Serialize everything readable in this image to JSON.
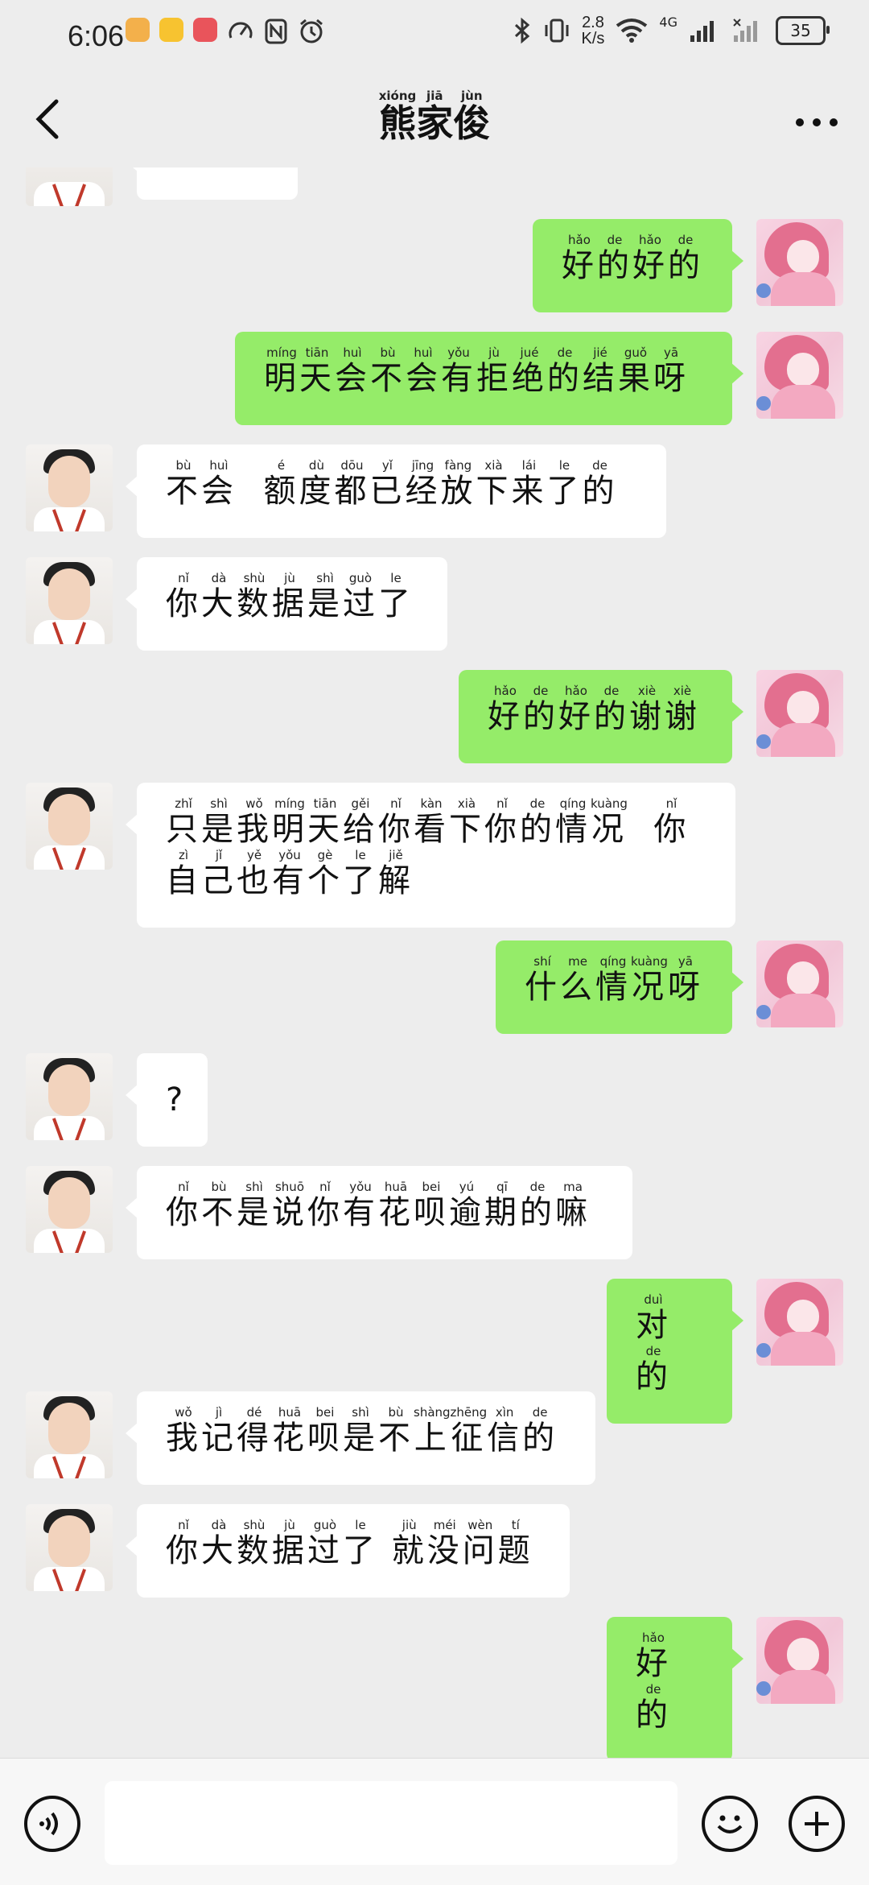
{
  "status_bar": {
    "time": "6:06",
    "net_speed_value": "2.8",
    "net_speed_unit": "K/s",
    "network_type": "4G",
    "battery_level": "35",
    "icons": [
      "bluetooth-icon",
      "vibrate-icon",
      "wifi-icon",
      "signal-icon",
      "nfc-icon",
      "alarm-icon"
    ]
  },
  "header": {
    "title_chars": [
      {
        "ch": "熊",
        "py": "xióng"
      },
      {
        "ch": "家",
        "py": "jiā"
      },
      {
        "ch": "俊",
        "py": "jùn"
      }
    ],
    "back_icon": "chevron-left-icon",
    "more_icon": "more-dots-icon"
  },
  "messages": [
    {
      "side": "right",
      "tokens": [
        {
          "ch": "好",
          "py": "hǎo"
        },
        {
          "ch": "的",
          "py": "de"
        },
        {
          "ch": "好",
          "py": "hǎo"
        },
        {
          "ch": "的",
          "py": "de"
        }
      ]
    },
    {
      "side": "right",
      "tokens": [
        {
          "ch": "明",
          "py": "míng"
        },
        {
          "ch": "天",
          "py": "tiān"
        },
        {
          "ch": "会",
          "py": "huì"
        },
        {
          "ch": "不",
          "py": "bù"
        },
        {
          "ch": "会",
          "py": "huì"
        },
        {
          "ch": "有",
          "py": "yǒu"
        },
        {
          "ch": "拒",
          "py": "jù"
        },
        {
          "ch": "绝",
          "py": "jué"
        },
        {
          "ch": "的",
          "py": "de"
        },
        {
          "ch": "结",
          "py": "jié"
        },
        {
          "ch": "果",
          "py": "guǒ"
        },
        {
          "ch": "呀",
          "py": "yā"
        }
      ]
    },
    {
      "side": "left",
      "tokens": [
        {
          "ch": "不",
          "py": "bù"
        },
        {
          "ch": "会",
          "py": "huì"
        },
        {
          "ch": "  ",
          "py": ""
        },
        {
          "ch": "额",
          "py": "é"
        },
        {
          "ch": "度",
          "py": "dù"
        },
        {
          "ch": "都",
          "py": "dōu"
        },
        {
          "ch": "已",
          "py": "yǐ"
        },
        {
          "ch": "经",
          "py": "jīng"
        },
        {
          "ch": "放",
          "py": "fàng"
        },
        {
          "ch": "下",
          "py": "xià"
        },
        {
          "ch": "来",
          "py": "lái"
        },
        {
          "ch": "了",
          "py": "le"
        },
        {
          "ch": "的",
          "py": "de"
        }
      ]
    },
    {
      "side": "left",
      "tokens": [
        {
          "ch": "你",
          "py": "nǐ"
        },
        {
          "ch": "大",
          "py": "dà"
        },
        {
          "ch": "数",
          "py": "shù"
        },
        {
          "ch": "据",
          "py": "jù"
        },
        {
          "ch": "是",
          "py": "shì"
        },
        {
          "ch": "过",
          "py": "guò"
        },
        {
          "ch": "了",
          "py": "le"
        }
      ]
    },
    {
      "side": "right",
      "tokens": [
        {
          "ch": "好",
          "py": "hǎo"
        },
        {
          "ch": "的",
          "py": "de"
        },
        {
          "ch": "好",
          "py": "hǎo"
        },
        {
          "ch": "的",
          "py": "de"
        },
        {
          "ch": "谢",
          "py": "xiè"
        },
        {
          "ch": "谢",
          "py": "xiè"
        }
      ]
    },
    {
      "side": "left",
      "tokens": [
        {
          "ch": "只",
          "py": "zhǐ"
        },
        {
          "ch": "是",
          "py": "shì"
        },
        {
          "ch": "我",
          "py": "wǒ"
        },
        {
          "ch": "明",
          "py": "míng"
        },
        {
          "ch": "天",
          "py": "tiān"
        },
        {
          "ch": "给",
          "py": "gěi"
        },
        {
          "ch": "你",
          "py": "nǐ"
        },
        {
          "ch": "看",
          "py": "kàn"
        },
        {
          "ch": "下",
          "py": "xià"
        },
        {
          "ch": "你",
          "py": "nǐ"
        },
        {
          "ch": "的",
          "py": "de"
        },
        {
          "ch": "情",
          "py": "qíng"
        },
        {
          "ch": "况",
          "py": "kuàng"
        },
        {
          "ch": "  ",
          "py": ""
        },
        {
          "ch": "你",
          "py": "nǐ"
        },
        {
          "ch": "自",
          "py": "zì"
        },
        {
          "ch": "己",
          "py": "jǐ"
        },
        {
          "ch": "也",
          "py": "yě"
        },
        {
          "ch": "有",
          "py": "yǒu"
        },
        {
          "ch": "个",
          "py": "gè"
        },
        {
          "ch": "了",
          "py": "le"
        },
        {
          "ch": "解",
          "py": "jiě"
        }
      ]
    },
    {
      "side": "right",
      "tokens": [
        {
          "ch": "什",
          "py": "shí"
        },
        {
          "ch": "么",
          "py": "me"
        },
        {
          "ch": "情",
          "py": "qíng"
        },
        {
          "ch": "况",
          "py": "kuàng"
        },
        {
          "ch": "呀",
          "py": "yā"
        }
      ]
    },
    {
      "side": "left",
      "tokens": [
        {
          "ch": "?",
          "py": ""
        }
      ]
    },
    {
      "side": "left",
      "tokens": [
        {
          "ch": "你",
          "py": "nǐ"
        },
        {
          "ch": "不",
          "py": "bù"
        },
        {
          "ch": "是",
          "py": "shì"
        },
        {
          "ch": "说",
          "py": "shuō"
        },
        {
          "ch": "你",
          "py": "nǐ"
        },
        {
          "ch": "有",
          "py": "yǒu"
        },
        {
          "ch": "花",
          "py": "huā"
        },
        {
          "ch": "呗",
          "py": "bei"
        },
        {
          "ch": "逾",
          "py": "yú"
        },
        {
          "ch": "期",
          "py": "qī"
        },
        {
          "ch": "的",
          "py": "de"
        },
        {
          "ch": "嘛",
          "py": "ma"
        }
      ]
    },
    {
      "side": "right",
      "tokens": [
        {
          "ch": "对",
          "py": "duì"
        },
        {
          "ch": "的",
          "py": "de"
        }
      ]
    },
    {
      "side": "left",
      "tokens": [
        {
          "ch": "我",
          "py": "wǒ"
        },
        {
          "ch": "记",
          "py": "jì"
        },
        {
          "ch": "得",
          "py": "dé"
        },
        {
          "ch": "花",
          "py": "huā"
        },
        {
          "ch": "呗",
          "py": "bei"
        },
        {
          "ch": "是",
          "py": "shì"
        },
        {
          "ch": "不",
          "py": "bù"
        },
        {
          "ch": "上",
          "py": "shàng"
        },
        {
          "ch": "征",
          "py": "zhēng"
        },
        {
          "ch": "信",
          "py": "xìn"
        },
        {
          "ch": "的",
          "py": "de"
        }
      ]
    },
    {
      "side": "left",
      "tokens": [
        {
          "ch": "你",
          "py": "nǐ"
        },
        {
          "ch": "大",
          "py": "dà"
        },
        {
          "ch": "数",
          "py": "shù"
        },
        {
          "ch": "据",
          "py": "jù"
        },
        {
          "ch": "过",
          "py": "guò"
        },
        {
          "ch": "了",
          "py": "le"
        },
        {
          "ch": " ",
          "py": ""
        },
        {
          "ch": "就",
          "py": "jiù"
        },
        {
          "ch": "没",
          "py": "méi"
        },
        {
          "ch": "问",
          "py": "wèn"
        },
        {
          "ch": "题",
          "py": "tí"
        }
      ]
    },
    {
      "side": "right",
      "tokens": [
        {
          "ch": "好",
          "py": "hǎo"
        },
        {
          "ch": "的",
          "py": "de"
        }
      ]
    }
  ],
  "input_bar": {
    "placeholder": "",
    "voice_icon": "voice-icon",
    "emoji_icon": "emoji-icon",
    "plus_icon": "plus-icon"
  },
  "colors": {
    "background": "#ededed",
    "sent_bubble": "#95ec69",
    "received_bubble": "#ffffff"
  }
}
